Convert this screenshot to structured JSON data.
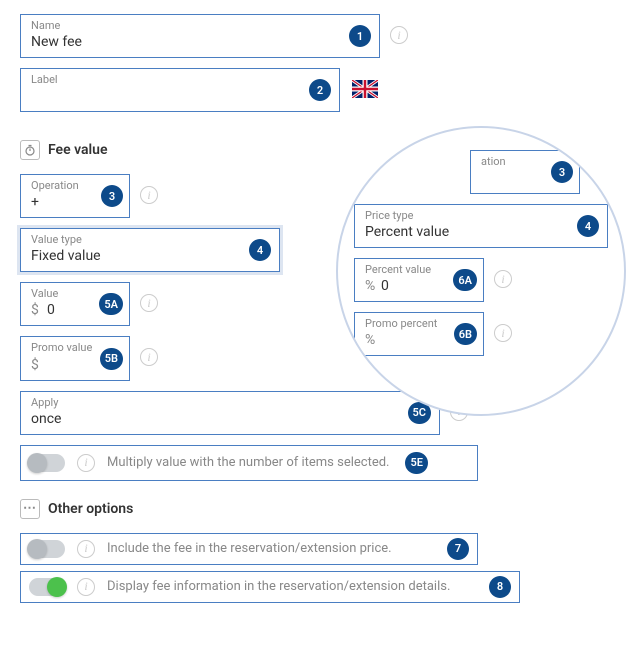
{
  "name": {
    "label": "Name",
    "value": "New fee",
    "badge": "1"
  },
  "label": {
    "label": "Label",
    "value": "",
    "badge": "2"
  },
  "fee_section": {
    "title": "Fee value"
  },
  "operation": {
    "label": "Operation",
    "value": "+",
    "badge": "3"
  },
  "value_type": {
    "label": "Value type",
    "value": "Fixed value",
    "badge": "4"
  },
  "value": {
    "label": "Value",
    "prefix": "$",
    "value": "0",
    "badge": "5A"
  },
  "promo_value": {
    "label": "Promo value",
    "prefix": "$",
    "value": "",
    "badge": "5B"
  },
  "apply": {
    "label": "Apply",
    "value": "once",
    "badge": "5C"
  },
  "multiply": {
    "label": "Multiply value with the number of items selected.",
    "badge": "5E"
  },
  "other_section": {
    "title": "Other options"
  },
  "include_fee": {
    "label": "Include the fee in the reservation/extension price.",
    "badge": "7"
  },
  "display_fee": {
    "label": "Display fee information in the reservation/extension details.",
    "badge": "8"
  },
  "callout_operation": {
    "label": "ation",
    "badge": "3"
  },
  "price_type": {
    "label": "Price type",
    "value": "Percent value",
    "badge": "4"
  },
  "percent_value": {
    "label": "Percent value",
    "prefix": "%",
    "value": "0",
    "badge": "6A"
  },
  "promo_percent": {
    "label": "Promo percent",
    "prefix": "%",
    "value": "",
    "badge": "6B"
  }
}
